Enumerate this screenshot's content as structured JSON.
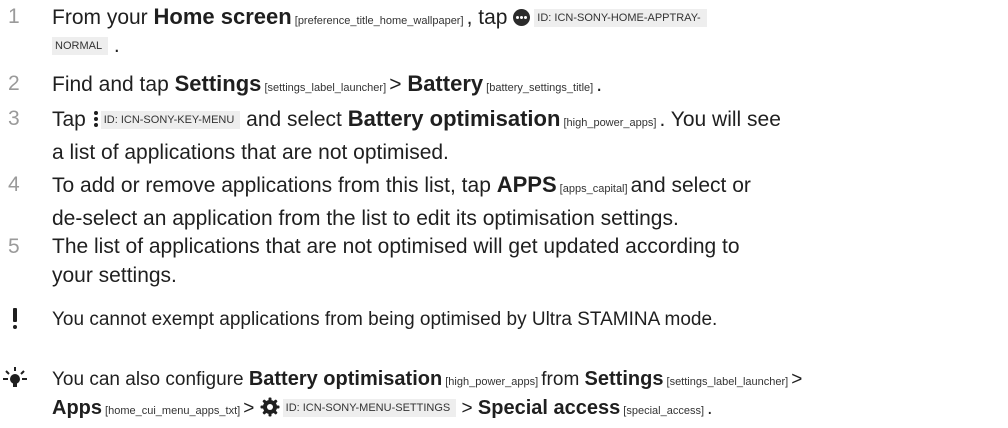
{
  "steps": [
    {
      "num": "1",
      "pre": "From your ",
      "bold1": "Home screen",
      "tag1": " [preference_title_home_wallpaper] ",
      "mid": ", tap ",
      "icon_name": "apptray-icon",
      "id1": "ID: ICN-SONY-HOME-APPTRAY-",
      "id2": "NORMAL",
      "end": " ."
    },
    {
      "num": "2",
      "pre": "Find and tap ",
      "bold1": "Settings",
      "tag1": " [settings_label_launcher] ",
      "sep": "> ",
      "bold2": "Battery",
      "tag2": " [battery_settings_title] ",
      "end": "."
    },
    {
      "num": "3",
      "pre": "Tap ",
      "icon_name": "overflow-menu-icon",
      "id": "ID: ICN-SONY-KEY-MENU",
      "mid": " and select ",
      "bold1": "Battery optimisation",
      "tag1": " [high_power_apps] ",
      "end": ". You will see",
      "line2": "a list of applications that are not optimised."
    },
    {
      "num": "4",
      "pre": "To add or remove applications from this list, tap ",
      "bold1": "APPS",
      "tag1": " [apps_capital] ",
      "end": "and select or",
      "line2": "de-select an application from the list to edit its optimisation settings."
    },
    {
      "num": "5",
      "line1": "The list of applications that are not optimised will get updated according to",
      "line2": "your settings."
    }
  ],
  "note": {
    "icon_name": "exclamation-icon",
    "text": "You cannot exempt applications from being optimised by Ultra STAMINA mode."
  },
  "tip": {
    "icon_name": "lightbulb-icon",
    "pre": "You can also configure ",
    "bold1": "Battery optimisation",
    "tag1": " [high_power_apps] ",
    "mid": "from ",
    "bold2": "Settings",
    "tag2": " [settings_label_launcher] ",
    "sep1": ">",
    "bold3": "Apps",
    "tag3": " [home_cui_menu_apps_txt] ",
    "sep2": "> ",
    "gear_icon_name": "gear-icon",
    "id": "ID: ICN-SONY-MENU-SETTINGS",
    "sep3": " > ",
    "bold4": "Special access",
    "tag4": " [special_access] ",
    "end": "."
  }
}
